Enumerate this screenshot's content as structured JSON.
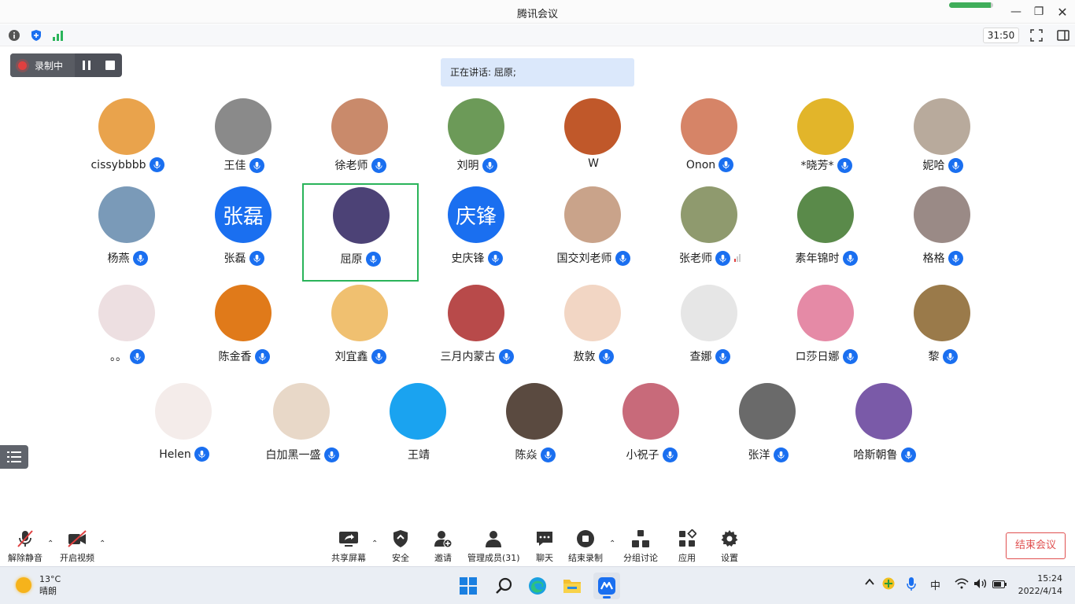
{
  "window": {
    "title": "腾讯会议"
  },
  "network": {
    "signal_level": 0.95,
    "color": "#3fae5a"
  },
  "statusbar": {
    "timer": "31:50"
  },
  "recording": {
    "label": "录制中"
  },
  "speaking": {
    "text": "正在讲话: 屈原;"
  },
  "participants": [
    {
      "name": "cissybbbb",
      "initials": "",
      "avatar_color": "#e9a34c"
    },
    {
      "name": "王佳",
      "initials": "",
      "avatar_color": "#8a8a8a"
    },
    {
      "name": "徐老师",
      "initials": "",
      "avatar_color": "#c98a6b"
    },
    {
      "name": "刘明",
      "initials": "",
      "avatar_color": "#6c9a58"
    },
    {
      "name": "W",
      "initials": "",
      "avatar_color": "#c0582a",
      "no_mic": true
    },
    {
      "name": "Onon",
      "initials": "",
      "avatar_color": "#d68467"
    },
    {
      "name": "*晓芳*",
      "initials": "",
      "avatar_color": "#e2b52a"
    },
    {
      "name": "妮哈",
      "initials": "",
      "avatar_color": "#b8aa9c"
    },
    {
      "name": "杨燕",
      "initials": "",
      "avatar_color": "#7a9ab8"
    },
    {
      "name": "张磊",
      "initials": "张磊",
      "avatar_color": "#1a6ff0"
    },
    {
      "name": "屈原",
      "initials": "",
      "avatar_color": "#4c4276",
      "active": true
    },
    {
      "name": "史庆锋",
      "initials": "庆锋",
      "avatar_color": "#1a6ff0"
    },
    {
      "name": "国交刘老师",
      "initials": "",
      "avatar_color": "#c9a38a"
    },
    {
      "name": "张老师",
      "initials": "",
      "avatar_color": "#8f9a6e",
      "weak_signal": true
    },
    {
      "name": "素年锦时",
      "initials": "",
      "avatar_color": "#5a8a4a"
    },
    {
      "name": "格格",
      "initials": "",
      "avatar_color": "#9a8a86"
    },
    {
      "name": "。。",
      "initials": "",
      "avatar_color": "#eddfe1"
    },
    {
      "name": "陈金香",
      "initials": "",
      "avatar_color": "#e07a1a"
    },
    {
      "name": "刘宜鑫",
      "initials": "",
      "avatar_color": "#f0c070"
    },
    {
      "name": "三月内蒙古",
      "initials": "",
      "avatar_color": "#b84a4a"
    },
    {
      "name": "敖敦",
      "initials": "",
      "avatar_color": "#f2d6c4"
    },
    {
      "name": "查娜",
      "initials": "",
      "avatar_color": "#e6e6e6"
    },
    {
      "name": "ロ莎日娜",
      "initials": "",
      "avatar_color": "#e58aa6"
    },
    {
      "name": "黎",
      "initials": "",
      "avatar_color": "#9a7a4a"
    },
    {
      "name": "Helen",
      "initials": "",
      "avatar_color": "#f4ecea"
    },
    {
      "name": "白加黑一盛",
      "initials": "",
      "avatar_color": "#e8d8c8"
    },
    {
      "name": "王靖",
      "initials": "",
      "avatar_color": "#1aa3f0",
      "no_mic": true
    },
    {
      "name": "陈焱",
      "initials": "",
      "avatar_color": "#5a4a40"
    },
    {
      "name": "小祝子",
      "initials": "",
      "avatar_color": "#c86a7a"
    },
    {
      "name": "张洋",
      "initials": "",
      "avatar_color": "#6a6a6a"
    },
    {
      "name": "哈斯朝鲁",
      "initials": "",
      "avatar_color": "#7a5aa8"
    }
  ],
  "toolbar": {
    "unmute": "解除静音",
    "start_video": "开启视频",
    "share": "共享屏幕",
    "security": "安全",
    "invite": "邀请",
    "manage": "管理成员(31)",
    "chat": "聊天",
    "end_record": "结束录制",
    "breakout": "分组讨论",
    "apps": "应用",
    "settings": "设置",
    "end_meeting": "结束会议"
  },
  "taskbar": {
    "temperature": "13°C",
    "weather": "晴朗",
    "ime": "中",
    "time": "15:24",
    "date": "2022/4/14"
  },
  "colors": {
    "accent": "#1a6ff0",
    "active_border": "#2ab45a",
    "danger": "#e05050"
  }
}
